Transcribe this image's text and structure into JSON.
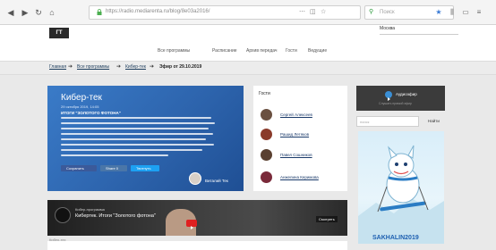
{
  "browser": {
    "nav_icons": [
      "back-icon",
      "forward-icon",
      "reload-icon",
      "home-icon"
    ],
    "url": "https://radio.mediarenta.ru/blog/8e03a2016/",
    "search_placeholder": "Поиск",
    "toolbar_icons": [
      "bookmark-star-icon",
      "library-icon",
      "sidebar-icon",
      "menu-icon"
    ]
  },
  "site": {
    "logo": "ГТ",
    "city": "Москва",
    "nav": [
      "Все программы",
      "Расписание",
      "Архив передач",
      "Гости",
      "Ведущие"
    ]
  },
  "breadcrumb": {
    "items": [
      "Главная",
      "Все программы",
      "Кибер-тек"
    ],
    "current": "Эфир от 29.10.2019"
  },
  "hero": {
    "title": "Кибер-тек",
    "date": "29 октября 2019, 14:05",
    "subtitle": "ИТОГИ \"ЗОЛОТОГО ФОТОНА\"",
    "share_labels": [
      "Сохранить",
      "Share 0",
      "Твитнуть"
    ],
    "author": "Виталий Тек",
    "accent": "#2d64ad"
  },
  "guests": {
    "title": "Гости",
    "items": [
      {
        "name": "Сергей Алексеев",
        "color": "#6a5040"
      },
      {
        "name": "Рашид Летяков",
        "color": "#8a3a2a"
      },
      {
        "name": "Павел Сошников",
        "color": "#5a4030"
      },
      {
        "name": "Анжелина Керимова",
        "color": "#7a2a3a"
      }
    ]
  },
  "sidebar": {
    "radio_label": "Аудиоэфир",
    "radio_sub": "Слушать прямой эфир",
    "search_placeholder": "поиск",
    "search_button": "Найти",
    "banner_text": "SAKHALIN2019"
  },
  "video": {
    "overline": "Кибер-программа",
    "title": "Кибертек. Итоги \"Золотого фотона\"",
    "button": "Смотреть",
    "caption": "Кибер-тех"
  }
}
